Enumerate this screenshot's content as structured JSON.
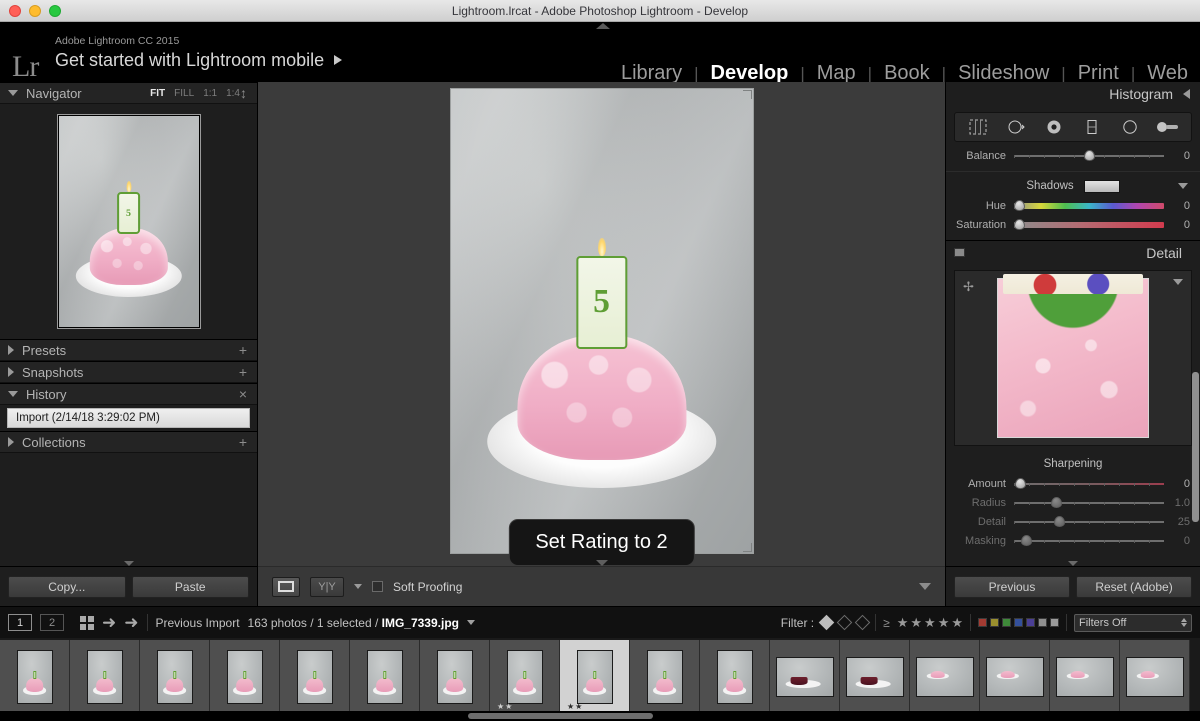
{
  "window": {
    "title": "Lightroom.lrcat - Adobe Photoshop Lightroom - Develop"
  },
  "identity": {
    "logo": "Lr",
    "product": "Adobe Lightroom CC 2015",
    "tagline": "Get started with Lightroom mobile",
    "arrow_icon": "play-triangle-icon"
  },
  "modules": [
    {
      "label": "Library",
      "active": false
    },
    {
      "label": "Develop",
      "active": true
    },
    {
      "label": "Map",
      "active": false
    },
    {
      "label": "Book",
      "active": false
    },
    {
      "label": "Slideshow",
      "active": false
    },
    {
      "label": "Print",
      "active": false
    },
    {
      "label": "Web",
      "active": false
    }
  ],
  "left_panel": {
    "navigator": {
      "title": "Navigator",
      "zoom_levels": [
        {
          "label": "FIT",
          "active": true
        },
        {
          "label": "FILL",
          "active": false
        },
        {
          "label": "1:1",
          "active": false
        },
        {
          "label": "1:4",
          "active": false
        }
      ]
    },
    "sections": [
      {
        "label": "Presets",
        "expanded": false,
        "action": "+"
      },
      {
        "label": "Snapshots",
        "expanded": false,
        "action": "+"
      },
      {
        "label": "History",
        "expanded": true,
        "action": "×"
      },
      {
        "label": "Collections",
        "expanded": false,
        "action": "+"
      }
    ],
    "history_items": [
      "Import (2/14/18 3:29:02 PM)"
    ],
    "buttons": {
      "copy": "Copy...",
      "paste": "Paste"
    }
  },
  "right_panel": {
    "histogram": {
      "title": "Histogram"
    },
    "tools": [
      "crop-overlay-icon",
      "spot-removal-icon",
      "red-eye-icon",
      "graduated-filter-icon",
      "radial-filter-icon",
      "adjustment-brush-icon"
    ],
    "split_tone": {
      "balance": {
        "label": "Balance",
        "value": "0"
      },
      "shadows_title": "Shadows",
      "hue": {
        "label": "Hue",
        "value": "0"
      },
      "saturation": {
        "label": "Saturation",
        "value": "0"
      }
    },
    "detail": {
      "title": "Detail",
      "sharpening_title": "Sharpening",
      "sliders": [
        {
          "label": "Amount",
          "value": "0",
          "dim": false
        },
        {
          "label": "Radius",
          "value": "1.0",
          "dim": true
        },
        {
          "label": "Detail",
          "value": "25",
          "dim": true
        },
        {
          "label": "Masking",
          "value": "0",
          "dim": true
        }
      ]
    },
    "buttons": {
      "previous": "Previous",
      "reset": "Reset (Adobe)"
    }
  },
  "center": {
    "toast": "Set Rating to 2",
    "toolbar": {
      "loupe_icon": "loupe-view-icon",
      "before_after_icon": "before-after-icon",
      "soft_proofing_label": "Soft Proofing",
      "soft_proofing_checked": false
    }
  },
  "filmstrip_bar": {
    "pages": [
      {
        "label": "1",
        "active": true
      },
      {
        "label": "2",
        "active": false
      }
    ],
    "grid_icon": "grid-view-icon",
    "back_icon": "arrow-left-icon",
    "forward_icon": "arrow-right-icon",
    "source": "Previous Import",
    "count_text": "163 photos / 1 selected / ",
    "filename": "IMG_7339.jpg",
    "filter_label": "Filter :",
    "star_count": 5,
    "gte_symbol": "≥",
    "color_labels": [
      "#a33b32",
      "#9a8f2e",
      "#3f8a3a",
      "#34509b",
      "#4b3f96",
      "#8f8f8f",
      "#9c9c9c"
    ],
    "filters_off": "Filters Off"
  },
  "filmstrip": {
    "thumbs": [
      {
        "type": "cake",
        "orient": "port",
        "selected": false,
        "rating": ""
      },
      {
        "type": "cake",
        "orient": "port",
        "selected": false,
        "rating": ""
      },
      {
        "type": "cake",
        "orient": "port",
        "selected": false,
        "rating": ""
      },
      {
        "type": "cake",
        "orient": "port",
        "selected": false,
        "rating": ""
      },
      {
        "type": "cake",
        "orient": "port",
        "selected": false,
        "rating": ""
      },
      {
        "type": "cake",
        "orient": "port",
        "selected": false,
        "rating": ""
      },
      {
        "type": "cake",
        "orient": "port",
        "selected": false,
        "rating": ""
      },
      {
        "type": "cake",
        "orient": "port",
        "selected": false,
        "rating": "★★"
      },
      {
        "type": "cake",
        "orient": "port",
        "selected": true,
        "rating": "★★"
      },
      {
        "type": "cake",
        "orient": "port",
        "selected": false,
        "rating": ""
      },
      {
        "type": "cake",
        "orient": "port",
        "selected": false,
        "rating": ""
      },
      {
        "type": "slice",
        "orient": "land",
        "selected": false,
        "rating": ""
      },
      {
        "type": "slice",
        "orient": "land",
        "selected": false,
        "rating": ""
      },
      {
        "type": "flat",
        "orient": "land",
        "selected": false,
        "rating": ""
      },
      {
        "type": "flat",
        "orient": "land",
        "selected": false,
        "rating": ""
      },
      {
        "type": "flat",
        "orient": "land",
        "selected": false,
        "rating": ""
      },
      {
        "type": "flat",
        "orient": "land",
        "selected": false,
        "rating": ""
      }
    ]
  },
  "photo": {
    "candle_number": "5"
  }
}
